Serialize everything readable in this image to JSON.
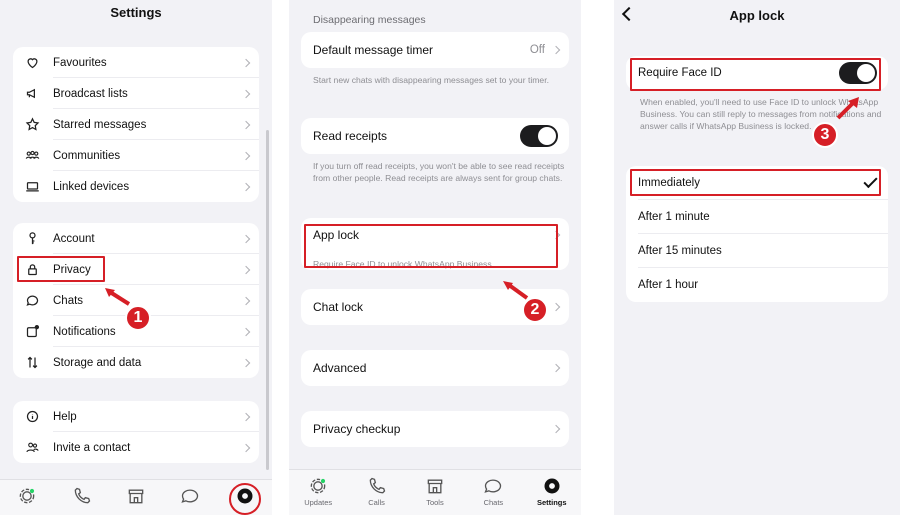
{
  "panel1": {
    "title": "Settings",
    "group1": [
      {
        "icon": "heart-icon",
        "label": "Favourites"
      },
      {
        "icon": "megaphone-icon",
        "label": "Broadcast lists"
      },
      {
        "icon": "star-icon",
        "label": "Starred messages"
      },
      {
        "icon": "communities-icon",
        "label": "Communities"
      },
      {
        "icon": "laptop-icon",
        "label": "Linked devices"
      }
    ],
    "group2": [
      {
        "icon": "key-icon",
        "label": "Account"
      },
      {
        "icon": "lock-icon",
        "label": "Privacy"
      },
      {
        "icon": "chat-bubble-icon",
        "label": "Chats"
      },
      {
        "icon": "notification-icon",
        "label": "Notifications"
      },
      {
        "icon": "storage-arrows-icon",
        "label": "Storage and data"
      }
    ],
    "group3": [
      {
        "icon": "info-icon",
        "label": "Help"
      },
      {
        "icon": "invite-people-icon",
        "label": "Invite a contact"
      }
    ],
    "badge": "1"
  },
  "panel2": {
    "section_header": "Disappearing messages",
    "default_timer_label": "Default message timer",
    "default_timer_value": "Off",
    "default_timer_desc": "Start new chats with disappearing messages set to your timer.",
    "read_receipts_label": "Read receipts",
    "read_receipts_desc": "If you turn off read receipts, you won't be able to see read receipts from other people. Read receipts are always sent for group chats.",
    "app_lock_label": "App lock",
    "app_lock_desc": "Require Face ID to unlock WhatsApp Business.",
    "chat_lock_label": "Chat lock",
    "advanced_label": "Advanced",
    "privacy_checkup_label": "Privacy checkup",
    "badge": "2",
    "tabs": [
      {
        "icon": "updates-icon",
        "label": "Updates"
      },
      {
        "icon": "phone-icon",
        "label": "Calls"
      },
      {
        "icon": "store-icon",
        "label": "Tools"
      },
      {
        "icon": "chats-icon",
        "label": "Chats"
      },
      {
        "icon": "settings-gear-icon",
        "label": "Settings"
      }
    ]
  },
  "panel3": {
    "title": "App lock",
    "require_face_id_label": "Require Face ID",
    "require_face_id_desc": "When enabled, you'll need to use Face ID to unlock WhatsApp Business. You can still reply to messages from notifications and answer calls if WhatsApp Business is locked.",
    "options": [
      "Immediately",
      "After 1 minute",
      "After 15 minutes",
      "After 1 hour"
    ],
    "selected_option": "Immediately",
    "badge": "3"
  },
  "colors": {
    "highlight": "#d61f26",
    "toggle_on": "#1c1c1e",
    "background": "#f2f2f6"
  }
}
